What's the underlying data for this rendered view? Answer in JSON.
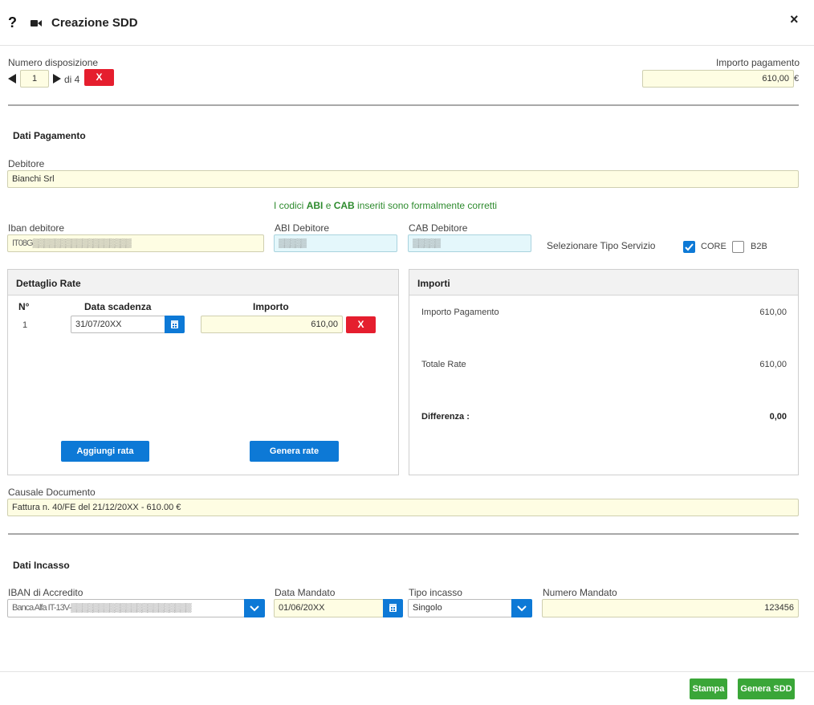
{
  "header": {
    "help": "?",
    "title": "Creazione SDD",
    "close": "×"
  },
  "disposizione": {
    "label": "Numero disposizione",
    "current": "1",
    "of": "di 4",
    "delete": "X"
  },
  "importo_pagamento": {
    "label": "Importo pagamento",
    "value": "610,00",
    "currency": "€"
  },
  "dati_pagamento": {
    "title": "Dati Pagamento",
    "debitore_label": "Debitore",
    "debitore_value": "Bianchi Srl",
    "validation": {
      "prefix": "I codici ",
      "abi": "ABI",
      "mid": " e ",
      "cab": "CAB",
      "suffix": " inseriti sono formalmente corretti"
    },
    "iban_label": "Iban debitore",
    "iban_value": "IT08G▒▒▒▒▒▒▒▒▒▒▒▒▒▒▒▒▒▒",
    "abi_label": "ABI Debitore",
    "abi_value": "▒▒▒▒▒",
    "cab_label": "CAB Debitore",
    "cab_value": "▒▒▒▒▒",
    "tipo_servizio_label": "Selezionare Tipo Servizio",
    "core_label": "CORE",
    "b2b_label": "B2B"
  },
  "dettaglio_rate": {
    "title": "Dettaglio Rate",
    "col_n": "N°",
    "col_data": "Data scadenza",
    "col_importo": "Importo",
    "rows": [
      {
        "n": "1",
        "data": "31/07/20XX",
        "importo": "610,00",
        "delete": "X"
      }
    ],
    "add_button": "Aggiungi rata",
    "generate_button": "Genera rate"
  },
  "importi": {
    "title": "Importi",
    "pagamento_label": "Importo Pagamento",
    "pagamento_value": "610,00",
    "totale_label": "Totale Rate",
    "totale_value": "610,00",
    "differenza_label": "Differenza :",
    "differenza_value": "0,00"
  },
  "causale": {
    "label": "Causale Documento",
    "value": "Fattura n. 40/FE del 21/12/20XX - 610.00 €"
  },
  "dati_incasso": {
    "title": "Dati Incasso",
    "iban_label": "IBAN di Accredito",
    "iban_value": "Banca Alfa IT-13V-▒▒▒▒▒▒▒▒▒▒▒▒▒▒▒▒▒▒▒▒▒▒",
    "data_mandato_label": "Data Mandato",
    "data_mandato_value": "01/06/20XX",
    "tipo_incasso_label": "Tipo incasso",
    "tipo_incasso_value": "Singolo",
    "numero_mandato_label": "Numero Mandato",
    "numero_mandato_value": "123456"
  },
  "footer": {
    "stampa": "Stampa",
    "genera": "Genera SDD"
  },
  "colors": {
    "accent_blue": "#0d79d6",
    "danger_red": "#e51e2e",
    "success_green": "#3aa638",
    "field_yellow": "#fefde3",
    "field_blue": "#e4f7fb",
    "validation_green": "#2e8b2e"
  }
}
